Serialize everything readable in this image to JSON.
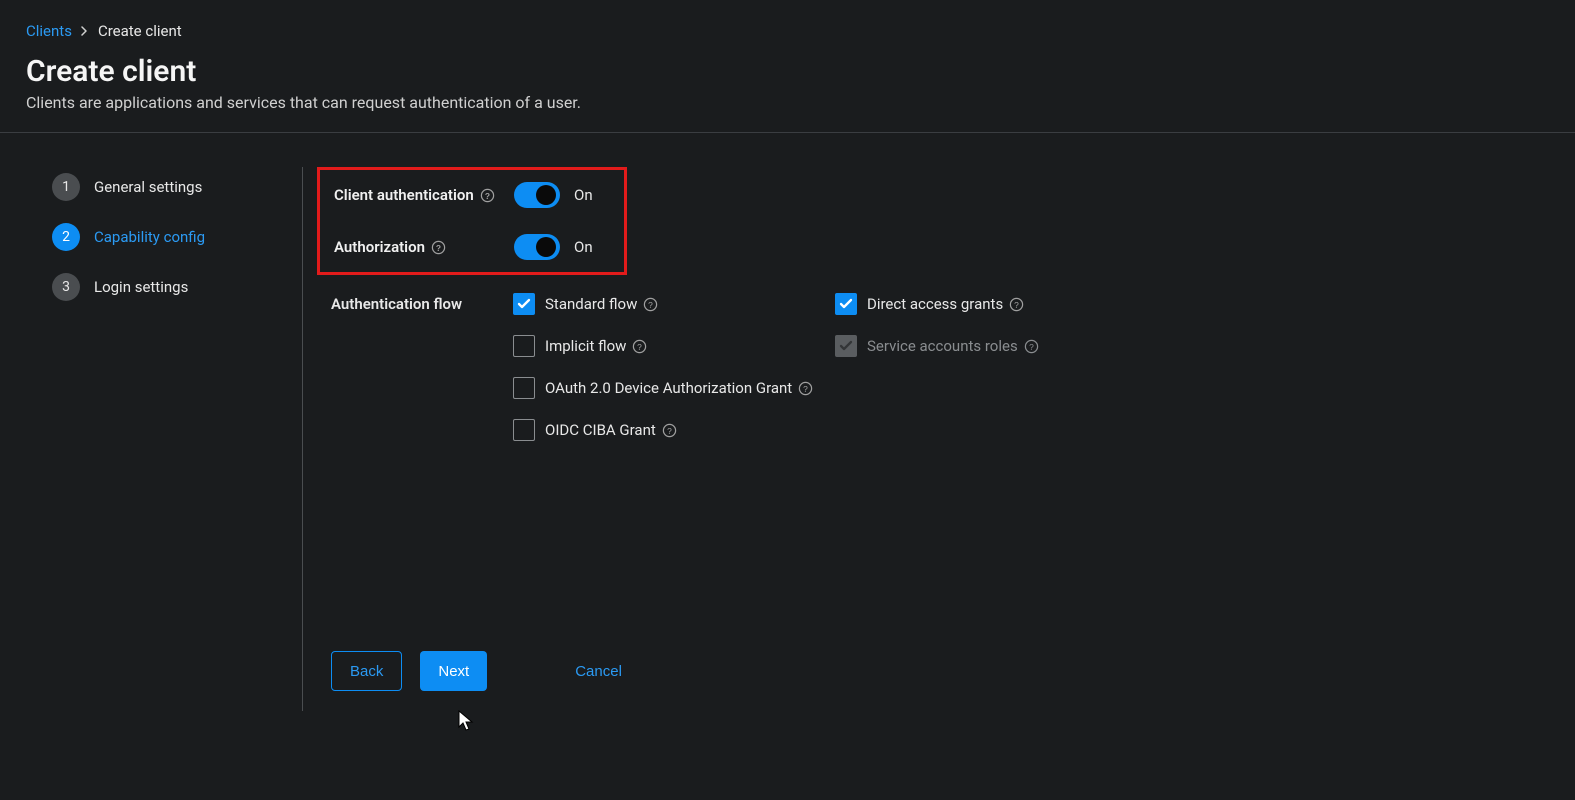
{
  "breadcrumb": {
    "root": "Clients",
    "current": "Create client"
  },
  "title": "Create client",
  "subtitle": "Clients are applications and services that can request authentication of a user.",
  "steps": [
    {
      "num": "1",
      "label": "General settings",
      "active": false
    },
    {
      "num": "2",
      "label": "Capability config",
      "active": true
    },
    {
      "num": "3",
      "label": "Login settings",
      "active": false
    }
  ],
  "clientAuth": {
    "label": "Client authentication",
    "state": "On"
  },
  "authorization": {
    "label": "Authorization",
    "state": "On"
  },
  "authFlow": {
    "label": "Authentication flow",
    "items": {
      "standard": {
        "label": "Standard flow",
        "checked": true,
        "disabled": false
      },
      "implicit": {
        "label": "Implicit flow",
        "checked": false,
        "disabled": false
      },
      "device": {
        "label": "OAuth 2.0 Device Authorization Grant",
        "checked": false,
        "disabled": false
      },
      "ciba": {
        "label": "OIDC CIBA Grant",
        "checked": false,
        "disabled": false
      },
      "direct": {
        "label": "Direct access grants",
        "checked": true,
        "disabled": false
      },
      "service": {
        "label": "Service accounts roles",
        "checked": true,
        "disabled": true
      }
    }
  },
  "buttons": {
    "back": "Back",
    "next": "Next",
    "cancel": "Cancel"
  }
}
